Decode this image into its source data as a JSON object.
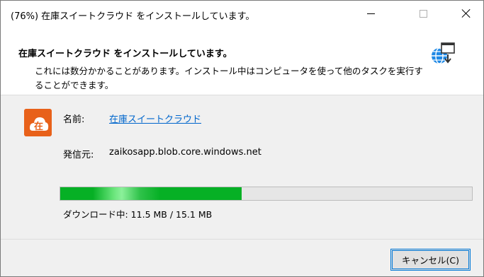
{
  "window": {
    "title": "(76%) 在庫スイートクラウド をインストールしています。"
  },
  "header": {
    "title": "在庫スイートクラウド をインストールしています。",
    "description": "これには数分かかることがあります。インストール中はコンピュータを使って他のタスクを実行することができます。",
    "icon": "globe-install-icon"
  },
  "app": {
    "icon": "zaiko-app-icon",
    "icon_glyph": "在",
    "name_label": "名前:",
    "name_value": "在庫スイートクラウド",
    "publisher_label": "発信元:",
    "publisher_value": "zaikosapp.blob.core.windows.net"
  },
  "progress": {
    "percent": 76,
    "fill_fraction": 0.44,
    "download_text": "ダウンロード中: 11.5 MB / 15.1 MB"
  },
  "footer": {
    "cancel_label": "キャンセル(C)"
  },
  "colors": {
    "progress_green": "#06b025",
    "link_blue": "#0066cc",
    "app_icon_orange": "#e8611a",
    "button_focus": "#0078d7"
  }
}
